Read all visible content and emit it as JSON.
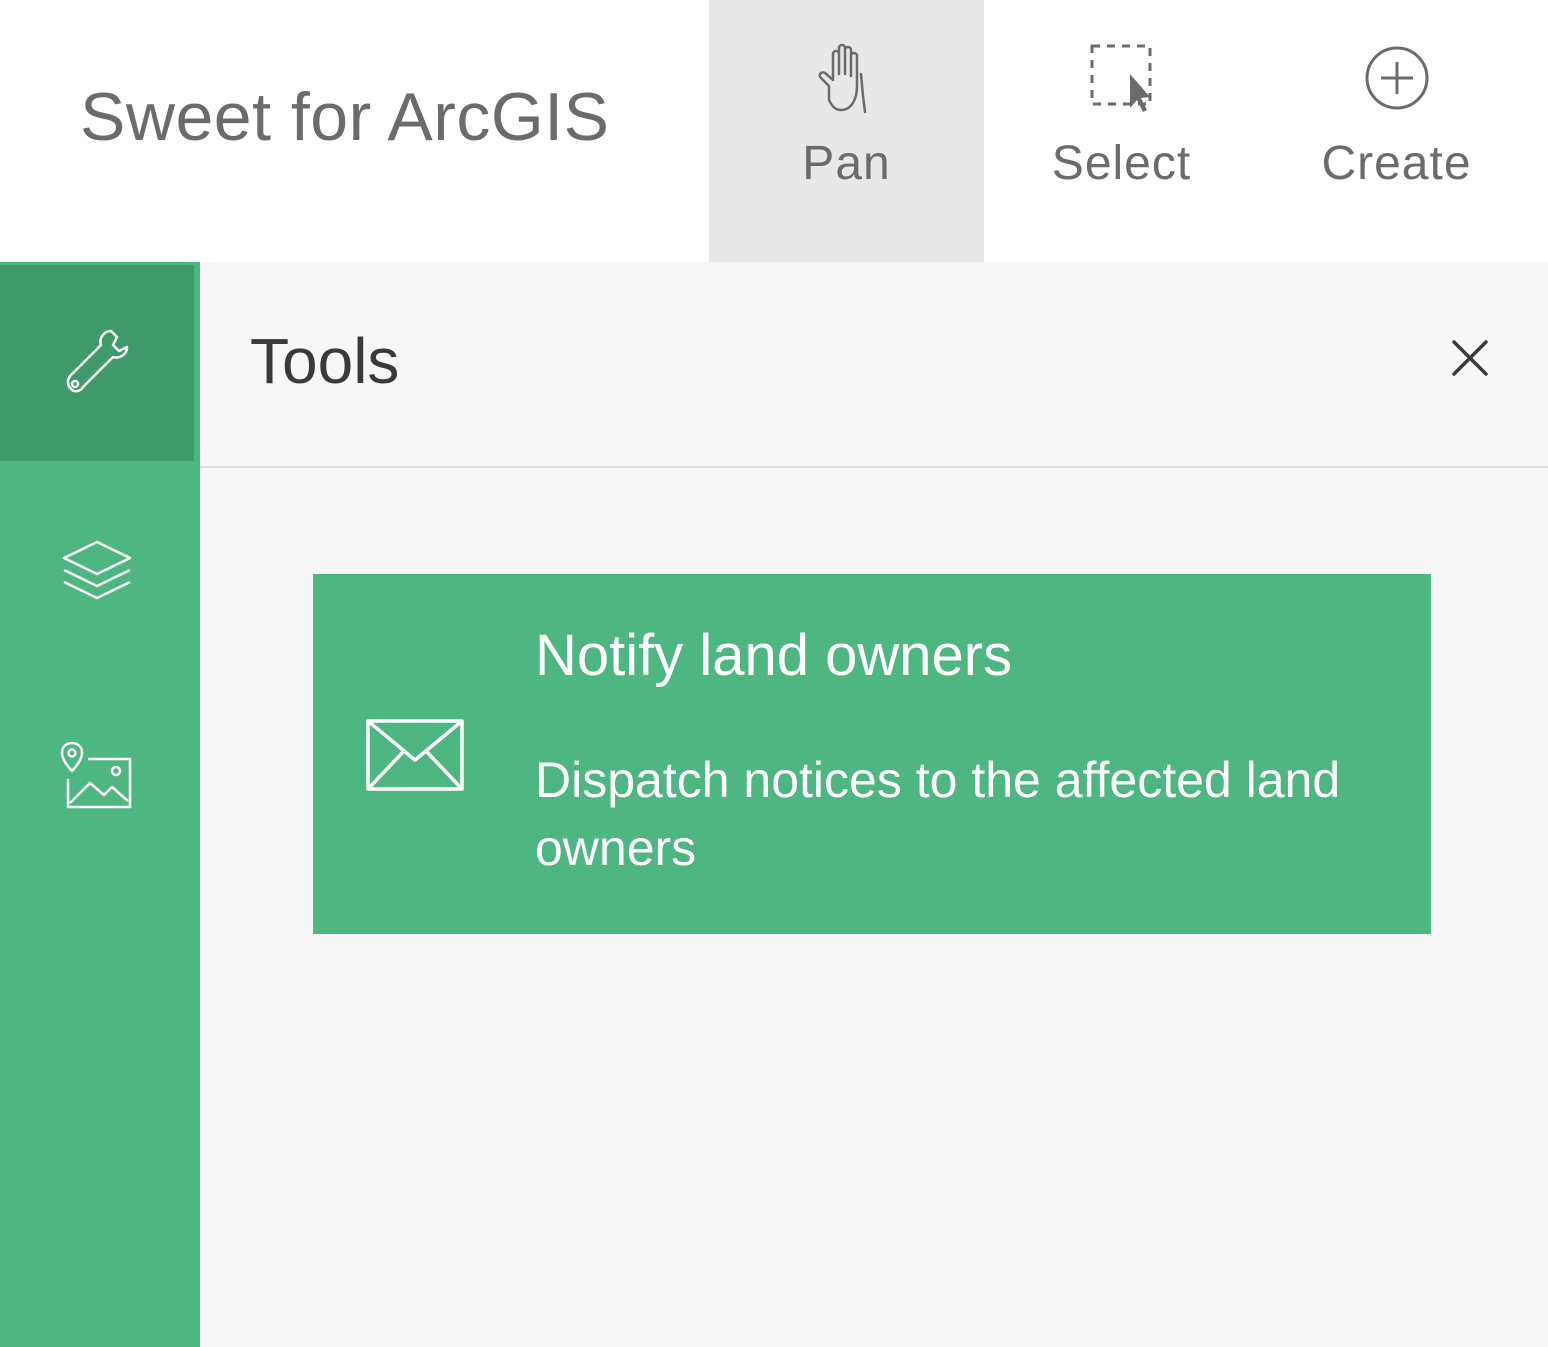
{
  "app": {
    "title": "Sweet for ArcGIS"
  },
  "toolbar": {
    "tools": [
      {
        "label": "Pan",
        "icon": "hand-icon",
        "active": true
      },
      {
        "label": "Select",
        "icon": "select-cursor-icon",
        "active": false
      },
      {
        "label": "Create",
        "icon": "plus-circle-icon",
        "active": false
      }
    ]
  },
  "sidebar": {
    "items": [
      {
        "icon": "wrench-icon",
        "active": true
      },
      {
        "icon": "layers-icon",
        "active": false
      },
      {
        "icon": "map-image-icon",
        "active": false
      }
    ]
  },
  "panel": {
    "title": "Tools",
    "close_icon": "close-icon",
    "tools": [
      {
        "icon": "envelope-icon",
        "title": "Notify land owners",
        "description": "Dispatch notices to the affected land owners"
      }
    ]
  },
  "colors": {
    "accent": "#4db681",
    "accent_active": "#3f9a6b",
    "toolbar_active": "#e8e8e8",
    "panel_bg": "#f7f7f7",
    "text_muted": "#6b6b6b"
  }
}
